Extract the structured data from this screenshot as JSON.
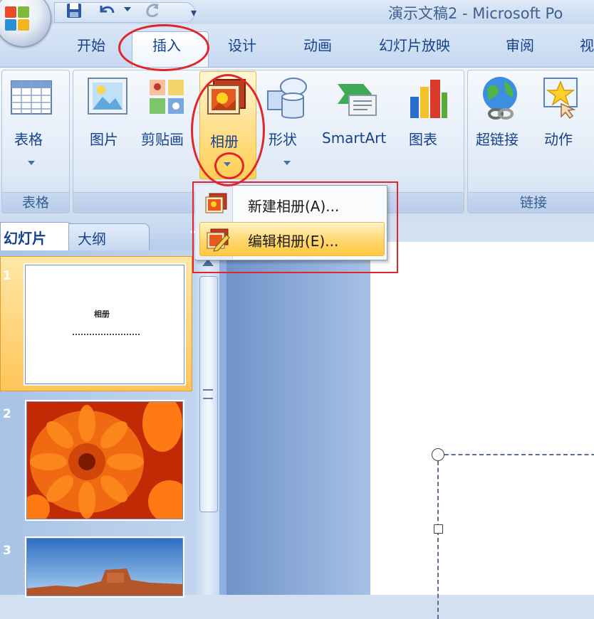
{
  "window": {
    "title": "演示文稿2 - Microsoft Po"
  },
  "quick_access": {
    "icons": [
      "save-icon",
      "undo-icon",
      "redo-icon",
      "customize-icon"
    ]
  },
  "tabs": [
    {
      "label": "开始"
    },
    {
      "label": "插入"
    },
    {
      "label": "设计"
    },
    {
      "label": "动画"
    },
    {
      "label": "幻灯片放映"
    },
    {
      "label": "审阅"
    },
    {
      "label": "视"
    }
  ],
  "ribbon": {
    "groups": [
      {
        "label": "表格",
        "buttons": [
          {
            "label": "表格",
            "icon": "table-icon"
          }
        ]
      },
      {
        "label": "",
        "buttons": [
          {
            "label": "图片",
            "icon": "picture-icon"
          },
          {
            "label": "剪贴画",
            "icon": "clipart-icon"
          },
          {
            "label": "相册",
            "icon": "photo-album-icon"
          },
          {
            "label": "形状",
            "icon": "shapes-icon"
          },
          {
            "label": "SmartArt",
            "icon": "smartart-icon"
          },
          {
            "label": "图表",
            "icon": "chart-icon"
          }
        ]
      },
      {
        "label": "链接",
        "buttons": [
          {
            "label": "超链接",
            "icon": "hyperlink-icon"
          },
          {
            "label": "动作",
            "icon": "action-icon"
          }
        ]
      }
    ]
  },
  "album_menu": {
    "items": [
      {
        "label": "新建相册(A)...",
        "icon": "new-album-icon"
      },
      {
        "label": "编辑相册(E)...",
        "icon": "edit-album-icon"
      }
    ]
  },
  "left_pane": {
    "tabs": [
      {
        "label": "幻灯片"
      },
      {
        "label": "大纲"
      }
    ],
    "slides": [
      {
        "number": "1",
        "title": "相册"
      },
      {
        "number": "2"
      },
      {
        "number": "3"
      }
    ]
  },
  "colors": {
    "accent": "#15428b",
    "annotation": "#e0262b",
    "highlight": "#ffd76e"
  }
}
